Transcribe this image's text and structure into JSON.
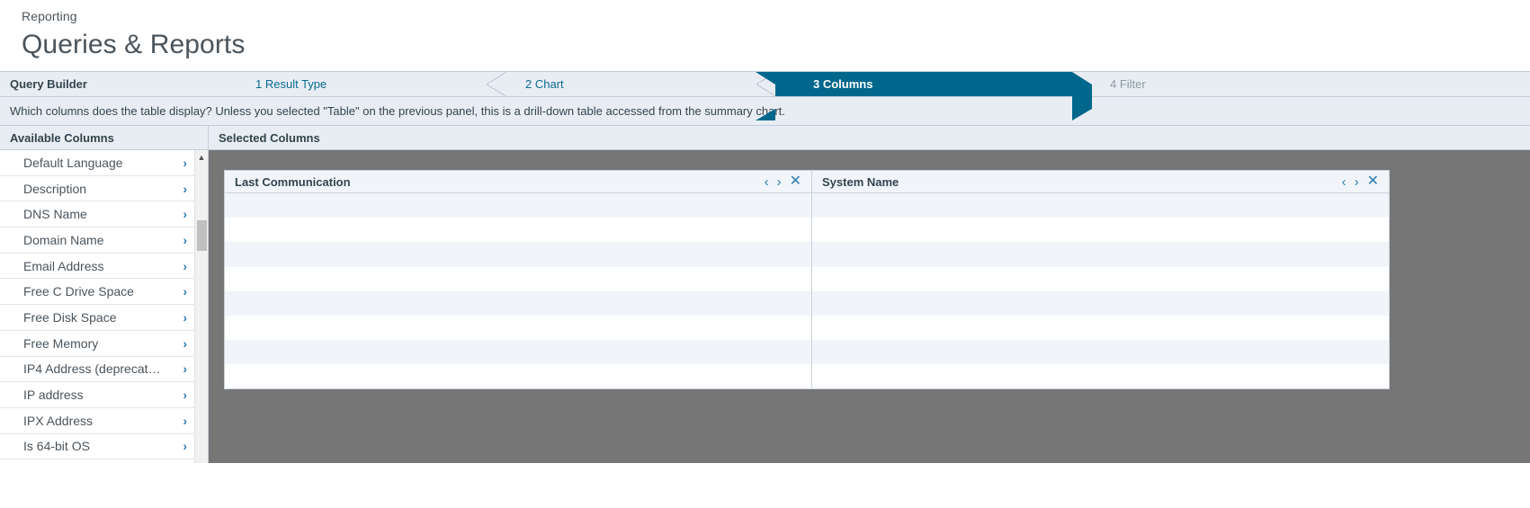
{
  "header": {
    "breadcrumb": "Reporting",
    "title": "Queries & Reports"
  },
  "wizard": {
    "label": "Query Builder",
    "steps": [
      {
        "text": "1 Result Type",
        "state": "completed"
      },
      {
        "text": "2 Chart",
        "state": "completed"
      },
      {
        "text": "3 Columns",
        "state": "active"
      },
      {
        "text": "4 Filter",
        "state": "disabled"
      }
    ],
    "active_color": "#00678C",
    "link_color": "#0A6B93",
    "disabled_color": "#8D9AA6"
  },
  "instruction": {
    "text": "Which columns does the table display? Unless you selected \"Table\" on the previous panel, this is a drill-down table accessed from the summary chart."
  },
  "available": {
    "title": "Available Columns",
    "chevron_icon": "›",
    "scroll_up_icon": "▲",
    "items": [
      {
        "label": "Default Language"
      },
      {
        "label": "Description"
      },
      {
        "label": "DNS Name"
      },
      {
        "label": "Domain Name"
      },
      {
        "label": "Email Address"
      },
      {
        "label": "Free C Drive Space"
      },
      {
        "label": "Free Disk Space"
      },
      {
        "label": "Free Memory"
      },
      {
        "label": "IP4 Address (deprecat…"
      },
      {
        "label": "IP address"
      },
      {
        "label": "IPX Address"
      },
      {
        "label": "Is 64-bit OS"
      }
    ]
  },
  "selected": {
    "title": "Selected Columns",
    "stage_color": "#767676",
    "move_left_icon": "‹",
    "move_right_icon": "›",
    "remove_icon": "✕",
    "columns": [
      {
        "title": "Last Communication",
        "rows": 8
      },
      {
        "title": "System Name",
        "rows": 8
      }
    ]
  }
}
